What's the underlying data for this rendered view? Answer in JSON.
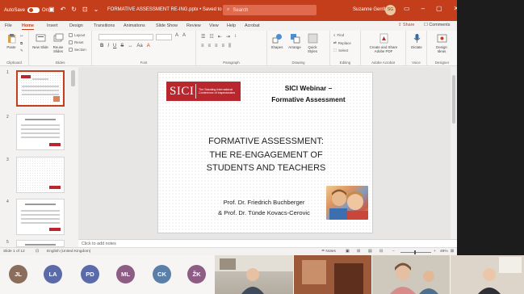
{
  "titlebar": {
    "autosave_label": "AutoSave",
    "autosave_state": "On",
    "doc_title": "FORMATIVE ASSESSMENT RE-ING.pptx • Saved to this PC",
    "search_placeholder": "Search",
    "user_name": "Suzanne Gerrit",
    "avatar_initials": "SG"
  },
  "tabs": [
    "File",
    "Home",
    "Insert",
    "Design",
    "Transitions",
    "Animations",
    "Slide Show",
    "Review",
    "View",
    "Help",
    "Acrobat"
  ],
  "active_tab": "Home",
  "share_label": "Share",
  "comments_label": "Comments",
  "ribbon": {
    "clipboard": {
      "label": "Clipboard",
      "paste": "Paste"
    },
    "slides": {
      "label": "Slides",
      "new_slide": "New Slide",
      "reuse_slides": "Reuse Slides",
      "layout": "Layout",
      "reset": "Reset",
      "section": "Section"
    },
    "font": {
      "label": "Font",
      "bold": "B",
      "italic": "I",
      "underline": "U",
      "strike": "S"
    },
    "paragraph": {
      "label": "Paragraph"
    },
    "drawing": {
      "label": "Drawing",
      "shapes": "Shapes",
      "arrange": "Arrange",
      "quick_styles": "Quick Styles"
    },
    "editing": {
      "label": "Editing",
      "find": "Find",
      "replace": "Replace",
      "select": "Select"
    },
    "adobe": {
      "label": "Adobe Acrobat",
      "create": "Create and Share Adobe PDF"
    },
    "voice": {
      "label": "Voice",
      "dictate": "Dictate"
    },
    "designer": {
      "label": "Designer",
      "design_ideas": "Design Ideas"
    }
  },
  "thumbnails": [
    {
      "number": "1",
      "title_lines": [
        "SICI Webinar –",
        "Formative Assessment",
        "FORMATIVE ASSESSMENT:",
        "THE RE-ENGAGEMENT OF",
        "STUDENTS AND TEACHERS"
      ]
    },
    {
      "number": "2",
      "title_lines": [
        "Formative assessment"
      ]
    },
    {
      "number": "3",
      "title_lines": []
    },
    {
      "number": "4",
      "title_lines": [
        "Overview of ERASMUS+"
      ]
    },
    {
      "number": "5",
      "title_lines": [
        "We decided upon assessment"
      ]
    }
  ],
  "slide": {
    "logo_mark": "SICI",
    "logo_text": "The Standing International Conference of Inspectorates",
    "title_line1": "SICI Webinar –",
    "title_line2": "Formative Assessment",
    "main_line1": "FORMATIVE ASSESSMENT:",
    "main_line2": "THE RE-ENGAGEMENT OF",
    "main_line3": "STUDENTS AND TEACHERS",
    "author1": "Prof. Dr. Friedrich Buchberger",
    "author2": "& Prof. Dr. Tünde Kovacs-Cerovic"
  },
  "notes_placeholder": "Click to add notes",
  "status": {
    "slide_count": "Slide 1 of 12",
    "language": "English (United Kingdom)",
    "notes_btn": "Notes",
    "zoom": "49%"
  },
  "participants": [
    {
      "initials": "JL",
      "color": "#8a6d5a"
    },
    {
      "initials": "LA",
      "color": "#5b6aa8"
    },
    {
      "initials": "PD",
      "color": "#5b6aa8"
    },
    {
      "initials": "ML",
      "color": "#8e5c84"
    },
    {
      "initials": "CK",
      "color": "#5b7fa8"
    },
    {
      "initials": "ŽK",
      "color": "#8e5c84"
    }
  ]
}
